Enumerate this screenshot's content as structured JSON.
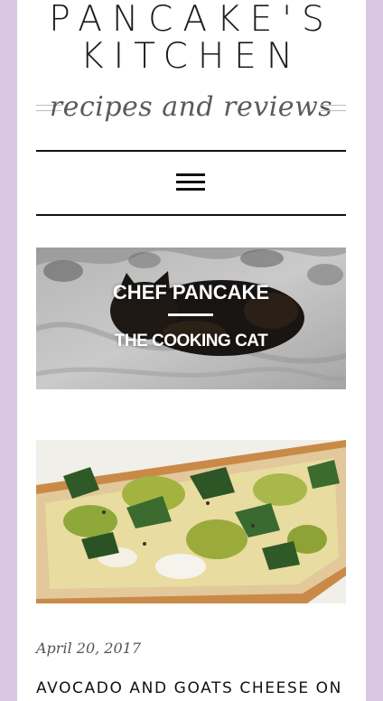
{
  "header": {
    "title_line1": "PANCAKE'S",
    "title_line2": "KITCHEN",
    "tagline": "recipes and reviews"
  },
  "nav": {
    "menu_icon": "hamburger-menu-icon"
  },
  "featured": {
    "title": "CHEF PANCAKE",
    "subtitle": "THE COOKING CAT"
  },
  "post": {
    "date": "April 20, 2017",
    "title": "AVOCADO AND GOATS CHEESE ON TOAST"
  },
  "colors": {
    "background": "#d9c7e3",
    "page": "#ffffff",
    "text": "#111111"
  }
}
